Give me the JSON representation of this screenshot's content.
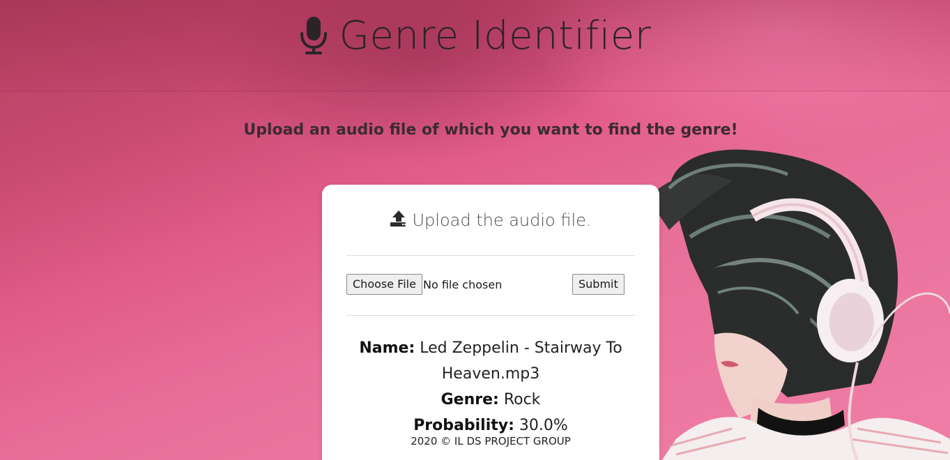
{
  "header": {
    "title": "Genre Identifier",
    "icon": "microphone-icon"
  },
  "subtitle": "Upload an audio file of which you want to find the genre!",
  "card": {
    "heading": "Upload the audio file.",
    "heading_icon": "upload-icon",
    "choose_file_label": "Choose File",
    "file_status": "No file chosen",
    "submit_label": "Submit"
  },
  "result": {
    "name_label": "Name:",
    "name_value": "Led Zeppelin - Stairway To Heaven.mp3",
    "genre_label": "Genre:",
    "genre_value": "Rock",
    "probability_label": "Probability:",
    "probability_value": "30.0%"
  },
  "footer": {
    "text": "2020 © IL DS PROJECT GROUP"
  },
  "colors": {
    "background_pink": "#e25c89",
    "background_dark": "#b4405f",
    "card": "#ffffff",
    "text": "#2f2a2c"
  }
}
